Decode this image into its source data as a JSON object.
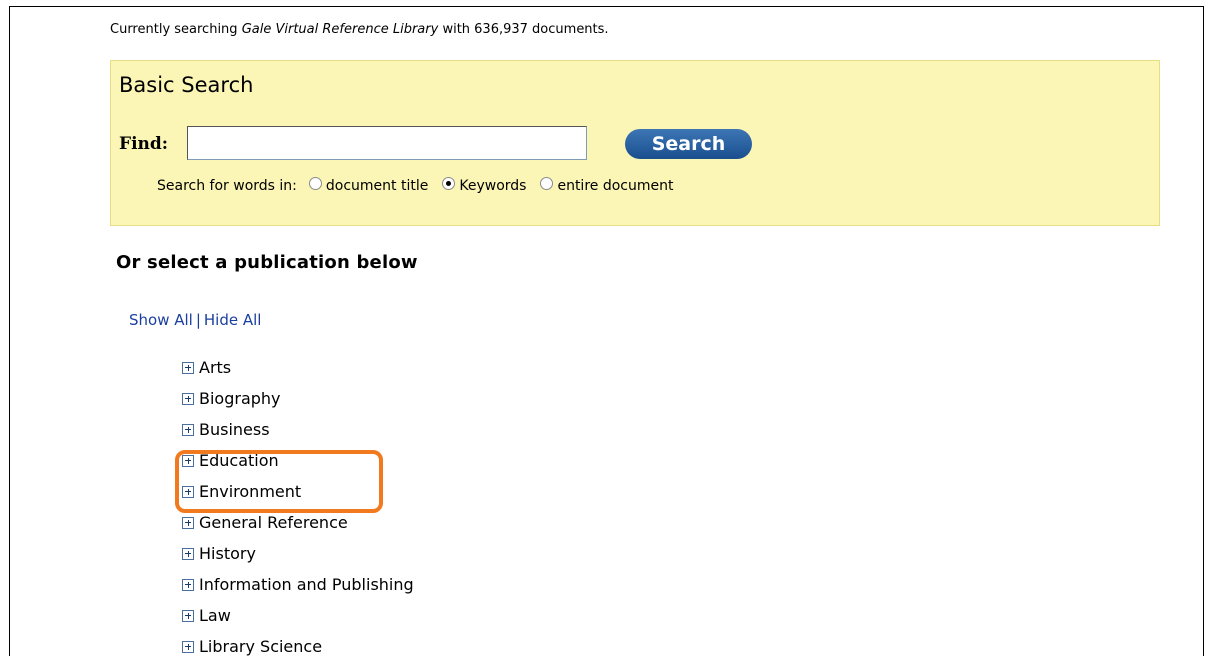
{
  "status": {
    "prefix": "Currently searching",
    "database": "Gale Virtual Reference Library",
    "suffix": "with  636,937  documents."
  },
  "search": {
    "title": "Basic Search",
    "find_label": "Find:",
    "find_value": "",
    "button_label": "Search",
    "search_in_label": "Search for words in:",
    "options": [
      {
        "label": "document title",
        "selected": false
      },
      {
        "label": "Keywords",
        "selected": true
      },
      {
        "label": "entire document",
        "selected": false
      }
    ]
  },
  "publications": {
    "heading": "Or select a publication below",
    "show_all": "Show All",
    "hide_all": "Hide All",
    "categories": [
      "Arts",
      "Biography",
      "Business",
      "Education",
      "Environment",
      "General Reference",
      "History",
      "Information and Publishing",
      "Law",
      "Library Science"
    ]
  },
  "colors": {
    "search_bg": "#fbf6b6",
    "button": "#2a5f9e",
    "link": "#1b3fa0",
    "highlight": "#f27a1e"
  }
}
